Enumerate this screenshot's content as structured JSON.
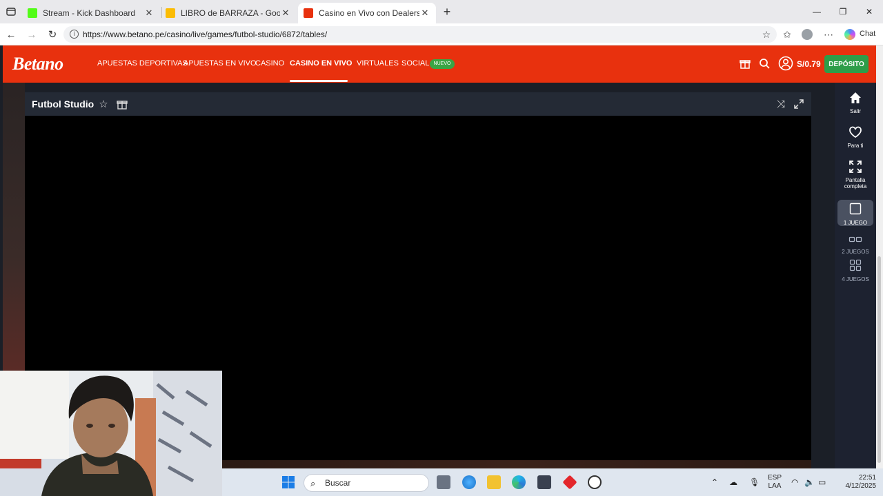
{
  "browser": {
    "tabs": [
      {
        "title": "Stream - Kick Dashboard",
        "favicon_color": "#53fc18",
        "active": false
      },
      {
        "title": "LIBRO de BARRAZA - Google Drive",
        "favicon_color": "#fbbc04",
        "active": false
      },
      {
        "title": "Casino en Vivo con Dealers Online",
        "favicon_color": "#e8310e",
        "active": true
      }
    ],
    "url": "https://www.betano.pe/casino/live/games/futbol-studio/6872/tables/",
    "chat_label": "Chat"
  },
  "site": {
    "logo": "Betano",
    "brand_color": "#e8310e",
    "nav": [
      {
        "label": "APUESTAS DEPORTIVAS",
        "active": false
      },
      {
        "label": "APUESTAS EN VIVO",
        "active": false
      },
      {
        "label": "CASINO",
        "active": false
      },
      {
        "label": "CASINO EN VIVO",
        "active": true
      },
      {
        "label": "VIRTUALES",
        "active": false
      },
      {
        "label": "SOCIAL",
        "active": false
      }
    ],
    "social_badge": "NUEVO",
    "balance": "S/0.79",
    "deposit_label": "DEPÓSITO",
    "deposit_color": "#2e9d49"
  },
  "game": {
    "title": "Futbol Studio"
  },
  "rail": {
    "items": [
      {
        "label": "Salir",
        "icon": "home-icon",
        "selected": false
      },
      {
        "label": "Para ti",
        "icon": "heart-icon",
        "selected": false
      },
      {
        "label": "Pantalla completa",
        "icon": "fullscreen-icon",
        "selected": false
      },
      {
        "label": "1 JUEGO",
        "icon": "single-view-icon",
        "selected": true
      },
      {
        "label": "2 JUEGOS",
        "icon": "double-view-icon",
        "selected": false
      },
      {
        "label": "4 JUEGOS",
        "icon": "quad-view-icon",
        "selected": false
      }
    ]
  },
  "taskbar": {
    "search_placeholder": "Buscar",
    "language": "ESP",
    "layout": "LAA",
    "time": "22:51",
    "date": "4/12/2025"
  }
}
